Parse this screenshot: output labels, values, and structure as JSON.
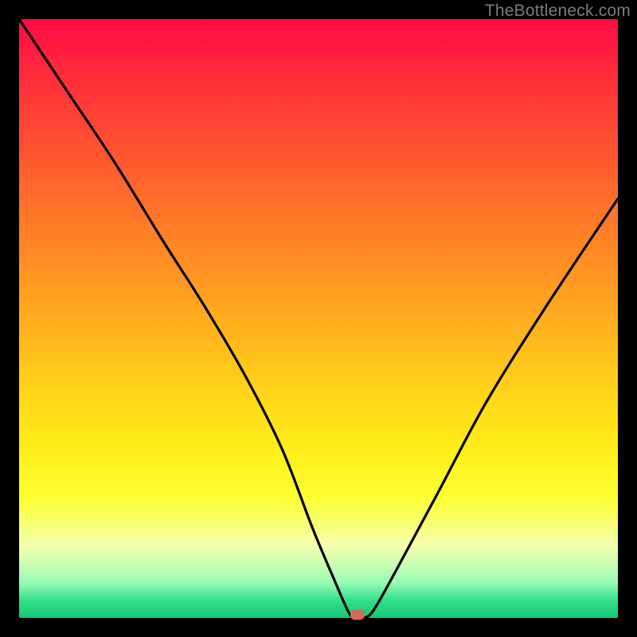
{
  "watermark": "TheBottleneck.com",
  "chart_data": {
    "type": "line",
    "title": "",
    "xlabel": "",
    "ylabel": "",
    "xlim": [
      0,
      100
    ],
    "ylim": [
      0,
      100
    ],
    "series": [
      {
        "name": "bottleneck-curve",
        "x": [
          0,
          8,
          16,
          24,
          31,
          38,
          44,
          49,
          53,
          55,
          56,
          57,
          59,
          63,
          70,
          78,
          88,
          100
        ],
        "values": [
          100,
          88,
          76,
          63,
          52,
          40,
          28,
          15,
          5.5,
          1,
          0,
          0,
          1,
          8,
          21,
          36,
          52,
          70
        ]
      }
    ],
    "marker": {
      "x": 56.5,
      "y": 0.5,
      "name": "min-point"
    },
    "gradient_axis": "y",
    "gradient_meaning": "high=red (bad), low=green (good)"
  }
}
